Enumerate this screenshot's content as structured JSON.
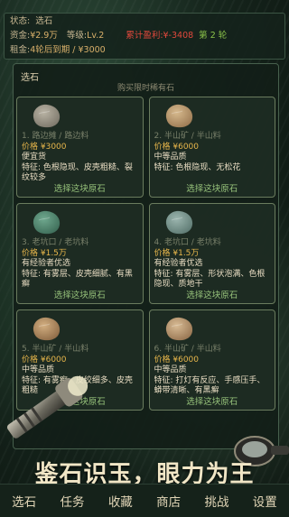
{
  "status": {
    "state_label": "状态:",
    "state_value": "选石",
    "funds_label": "资金:",
    "funds_value": "¥2.9万",
    "level_label": "等级:",
    "level_value": "Lv.2",
    "profit_label": "累计盈利:",
    "profit_value": "¥-3408",
    "round_text": "第 2 轮",
    "rent_label": "租金:",
    "rent_value": "4轮后到期 / ¥3000"
  },
  "panel": {
    "title": "选石",
    "subheading": "购买限时稀有石"
  },
  "stones": [
    {
      "position": "1. 路边摊 / 路边料",
      "price": "价格 ¥3000",
      "grade": "便宜货",
      "features": "特征: 色根隐现、皮壳粗糙、裂纹较多",
      "action": "选择这块原石",
      "colors": [
        "#b9b3a4",
        "#7d786c"
      ]
    },
    {
      "position": "2. 半山矿 / 半山料",
      "price": "价格 ¥6000",
      "grade": "中等品质",
      "features": "特征: 色根隐现、无松花",
      "action": "选择这块原石",
      "colors": [
        "#d6b98d",
        "#9d7b55"
      ]
    },
    {
      "position": "3. 老坑口 / 老坑料",
      "price": "价格 ¥1.5万",
      "grade": "有经验者优选",
      "features": "特征: 有雾层、皮壳细腻、有黑癣",
      "action": "选择这块原石",
      "colors": [
        "#6fa88e",
        "#3f6e5a"
      ]
    },
    {
      "position": "4. 老坑口 / 老坑料",
      "price": "价格 ¥1.5万",
      "grade": "有经验者优选",
      "features": "特征: 有雾层、形状泡满、色根隐现、质地干",
      "action": "选择这块原石",
      "colors": [
        "#9bb5ae",
        "#5f7b74"
      ]
    },
    {
      "position": "5. 半山矿 / 半山料",
      "price": "价格 ¥6000",
      "grade": "中等品质",
      "features": "特征: 有雾癣、皮绞细多、皮壳粗糙",
      "action": "选择这块原石",
      "colors": [
        "#d2ae80",
        "#8f6c48"
      ]
    },
    {
      "position": "6. 半山矿 / 半山料",
      "price": "价格 ¥6000",
      "grade": "中等品质",
      "features": "特征: 打灯有反应、手感压手、蟒带清晰、有黑癣",
      "action": "选择这块原石",
      "colors": [
        "#d8bb94",
        "#987653"
      ]
    }
  ],
  "slogan": "鉴石识玉，眼力为王",
  "nav": [
    "选石",
    "任务",
    "收藏",
    "商店",
    "挑战",
    "设置"
  ]
}
